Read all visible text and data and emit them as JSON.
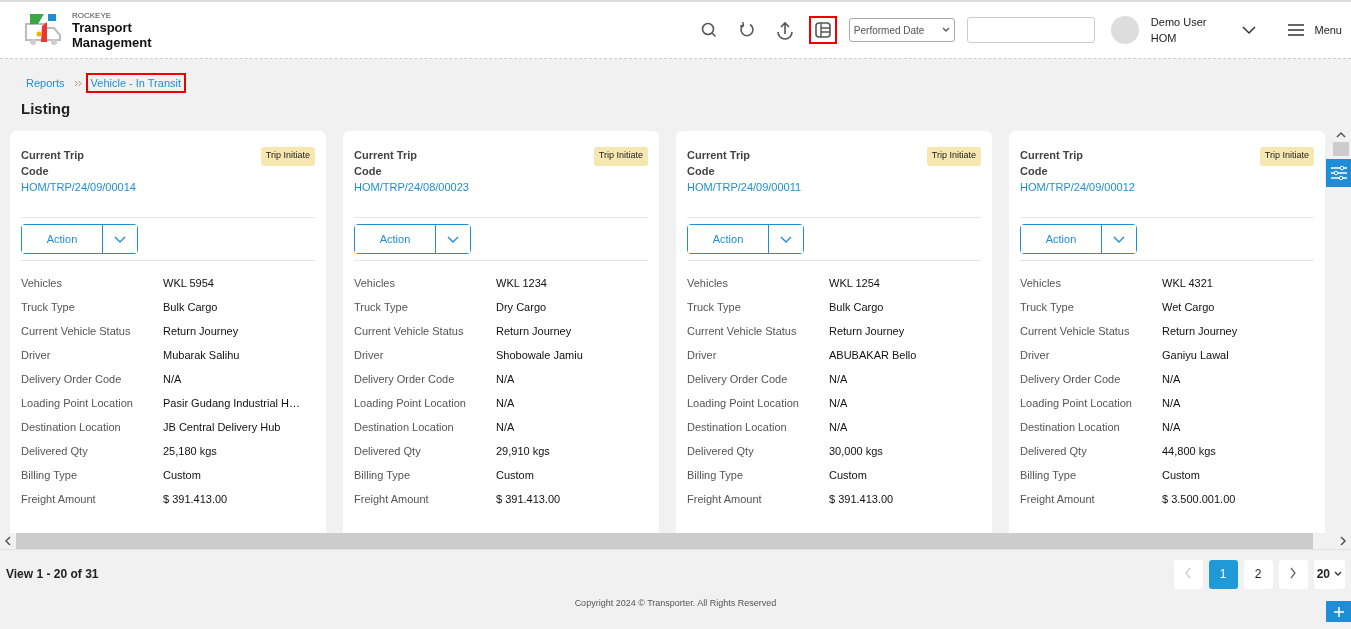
{
  "header": {
    "logo": {
      "brand": "ROCKEYE",
      "title_line_1": "Transport",
      "title_line_2": "Management"
    },
    "toolbar": [
      {
        "kind": "search",
        "highlighted": false
      },
      {
        "kind": "refresh",
        "highlighted": false
      },
      {
        "kind": "upload",
        "highlighted": false
      },
      {
        "kind": "layout",
        "highlighted": true
      }
    ],
    "date_filter": {
      "value": "Performed Date"
    },
    "user": {
      "name": "Demo User",
      "branch": "HOM"
    },
    "menu": {
      "label": "Menu"
    }
  },
  "breadcrumb": [
    {
      "label": "Reports",
      "highlighted": false
    },
    {
      "label": "Vehicle - In Transit",
      "highlighted": true
    }
  ],
  "page_title": "Listing",
  "cards": [
    {
      "title": "Current Trip Code",
      "status": "Trip Initiate",
      "code": "HOM/TRP/24/09/00014",
      "action": "Action",
      "fields": [
        {
          "label": "Vehicles",
          "value": "WKL 5954"
        },
        {
          "label": "Truck Type",
          "value": "Bulk Cargo"
        },
        {
          "label": "Current Vehicle Status",
          "value": "Return Journey"
        },
        {
          "label": "Driver",
          "value": "Mubarak Salihu"
        },
        {
          "label": "Delivery Order Code",
          "value": "N/A"
        },
        {
          "label": "Loading Point Location",
          "value": "Pasir Gudang Industrial H…"
        },
        {
          "label": "Destination Location",
          "value": "JB Central Delivery Hub"
        },
        {
          "label": "Delivered Qty",
          "value": "25,180 kgs"
        },
        {
          "label": "Billing Type",
          "value": "Custom"
        },
        {
          "label": "Freight Amount",
          "value": "$ 391.413.00"
        }
      ]
    },
    {
      "title": "Current Trip Code",
      "status": "Trip Initiate",
      "code": "HOM/TRP/24/08/00023",
      "action": "Action",
      "fields": [
        {
          "label": "Vehicles",
          "value": "WKL 1234"
        },
        {
          "label": "Truck Type",
          "value": "Dry Cargo"
        },
        {
          "label": "Current Vehicle Status",
          "value": "Return Journey"
        },
        {
          "label": "Driver",
          "value": "Shobowale Jamiu"
        },
        {
          "label": "Delivery Order Code",
          "value": "N/A"
        },
        {
          "label": "Loading Point Location",
          "value": "N/A"
        },
        {
          "label": "Destination Location",
          "value": "N/A"
        },
        {
          "label": "Delivered Qty",
          "value": "29,910 kgs"
        },
        {
          "label": "Billing Type",
          "value": "Custom"
        },
        {
          "label": "Freight Amount",
          "value": "$ 391.413.00"
        }
      ]
    },
    {
      "title": "Current Trip Code",
      "status": "Trip Initiate",
      "code": "HOM/TRP/24/09/00011",
      "action": "Action",
      "fields": [
        {
          "label": "Vehicles",
          "value": "WKL 1254"
        },
        {
          "label": "Truck Type",
          "value": "Bulk Cargo"
        },
        {
          "label": "Current Vehicle Status",
          "value": "Return Journey"
        },
        {
          "label": "Driver",
          "value": "ABUBAKAR Bello"
        },
        {
          "label": "Delivery Order Code",
          "value": "N/A"
        },
        {
          "label": "Loading Point Location",
          "value": "N/A"
        },
        {
          "label": "Destination Location",
          "value": "N/A"
        },
        {
          "label": "Delivered Qty",
          "value": "30,000 kgs"
        },
        {
          "label": "Billing Type",
          "value": "Custom"
        },
        {
          "label": "Freight Amount",
          "value": "$ 391.413.00"
        }
      ]
    },
    {
      "title": "Current Trip Code",
      "status": "Trip Initiate",
      "code": "HOM/TRP/24/09/00012",
      "action": "Action",
      "fields": [
        {
          "label": "Vehicles",
          "value": "WKL 4321"
        },
        {
          "label": "Truck Type",
          "value": "Wet Cargo"
        },
        {
          "label": "Current Vehicle Status",
          "value": "Return Journey"
        },
        {
          "label": "Driver",
          "value": "Ganiyu Lawal"
        },
        {
          "label": "Delivery Order Code",
          "value": "N/A"
        },
        {
          "label": "Loading Point Location",
          "value": "N/A"
        },
        {
          "label": "Destination Location",
          "value": "N/A"
        },
        {
          "label": "Delivered Qty",
          "value": "44,800 kgs"
        },
        {
          "label": "Billing Type",
          "value": "Custom"
        },
        {
          "label": "Freight Amount",
          "value": "$ 3.500.001.00"
        }
      ]
    }
  ],
  "footer": {
    "summary": "View 1 - 20 of 31",
    "pages": [
      {
        "label": "1",
        "selected": true
      },
      {
        "label": "2",
        "selected": false
      }
    ],
    "page_size": "20",
    "copyright": "Copyright 2024 © Transporter. All Rights Reserved"
  }
}
